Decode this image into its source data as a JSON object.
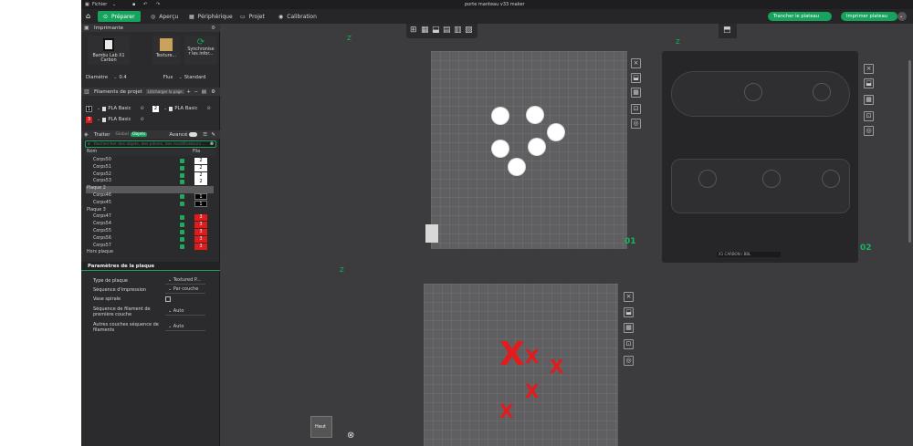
{
  "window": {
    "file_menu": "Fichier",
    "title": "porte manteau v33 maker"
  },
  "menubar": {
    "tabs": [
      {
        "label": "Préparer",
        "icon": "prepare-icon",
        "active": true
      },
      {
        "label": "Aperçu",
        "icon": "preview-icon",
        "active": false
      },
      {
        "label": "Périphérique",
        "icon": "device-icon",
        "active": false
      },
      {
        "label": "Projet",
        "icon": "project-icon",
        "active": false
      },
      {
        "label": "Calibration",
        "icon": "calibration-icon",
        "active": false
      }
    ],
    "slice_button": "Trancher le plateau",
    "print_button": "Imprimer plateau",
    "accent": "#17a35e"
  },
  "left": {
    "printer": {
      "section": "Imprimante",
      "printer_name": "Bambu Lab X1 Carbon",
      "plate_label": "Texture...",
      "sync_label_1": "Synchronise",
      "sync_label_2": "r les infor...",
      "diameter_label": "Diamètre",
      "diameter_value": "0.4",
      "flow_label": "Flux",
      "flow_value": "Standard"
    },
    "filaments": {
      "section": "Filaments de projet",
      "hint": "Lit/charger la page",
      "items": [
        {
          "index": "1",
          "name": "PLA Basic",
          "color": "#000000"
        },
        {
          "index": "2",
          "name": "PLA Basic",
          "color": "#ffffff"
        },
        {
          "index": "3",
          "name": "PLA Basic",
          "color": "#e01b1b"
        }
      ]
    },
    "process": {
      "section": "Traiter",
      "global_label": "Global",
      "objects_label": "Objets",
      "advanced_label": "Avancé",
      "search_placeholder": "Rechercher des objets, des pièces, des modificateurs ...",
      "col_name": "Nom",
      "col_fila": "Fila",
      "tree": [
        {
          "label": "Corps50",
          "fila": "2",
          "kind": "w"
        },
        {
          "label": "Corps51",
          "fila": "2",
          "kind": "w"
        },
        {
          "label": "Corps52",
          "fila": "2",
          "kind": "w"
        },
        {
          "label": "Corps53",
          "fila": "2",
          "kind": "w"
        },
        {
          "label": "Plaque 2",
          "fila": "",
          "kind": "group"
        },
        {
          "label": "Corps46",
          "fila": "1",
          "kind": "b"
        },
        {
          "label": "Corps45",
          "fila": "1",
          "kind": "b"
        },
        {
          "label": "Plaque 3",
          "fila": "",
          "kind": "plate"
        },
        {
          "label": "Corps47",
          "fila": "3",
          "kind": "r"
        },
        {
          "label": "Corps54",
          "fila": "3",
          "kind": "r"
        },
        {
          "label": "Corps55",
          "fila": "3",
          "kind": "r"
        },
        {
          "label": "Corps56",
          "fila": "3",
          "kind": "r"
        },
        {
          "label": "Corps57",
          "fila": "3",
          "kind": "r"
        },
        {
          "label": "Hors plaque",
          "fila": "",
          "kind": "plate"
        }
      ]
    },
    "plate_params": {
      "section": "Paramètres de la plaque",
      "rows": [
        {
          "label": "Type de plaque",
          "value": "Textured P..."
        },
        {
          "label": "Séquence d'impression",
          "value": "Par couche"
        },
        {
          "label": "Vase spirale",
          "value": ""
        },
        {
          "label": "Séquence de filament de première couche",
          "value": "Auto"
        },
        {
          "label": "Autres couches séquence de filaments",
          "value": "Auto"
        }
      ]
    }
  },
  "viewport": {
    "plate1_number": "01",
    "plate2_number": "02",
    "z_label": "Z",
    "view_label": "Haut",
    "plate2_badge": "X1 CARBON / BBL"
  }
}
